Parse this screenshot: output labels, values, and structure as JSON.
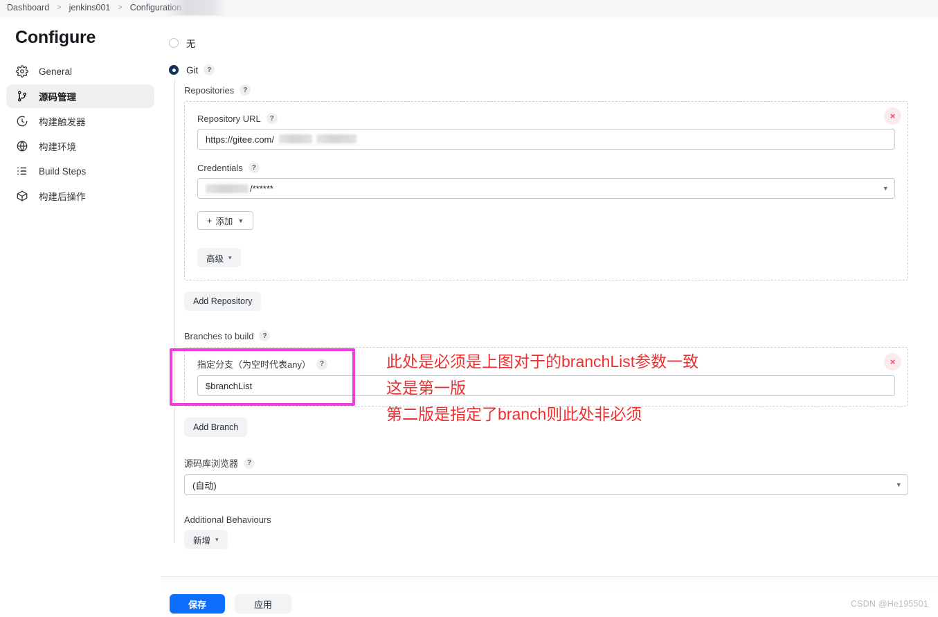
{
  "breadcrumb": {
    "items": [
      "Dashboard",
      "jenkins001",
      "Configuration"
    ],
    "separator": ">"
  },
  "sidebar": {
    "title": "Configure",
    "items": [
      {
        "label": "General",
        "icon": "gear-icon",
        "active": false
      },
      {
        "label": "源码管理",
        "icon": "git-branch-icon",
        "active": true
      },
      {
        "label": "构建触发器",
        "icon": "clock-icon",
        "active": false
      },
      {
        "label": "构建环境",
        "icon": "globe-icon",
        "active": false
      },
      {
        "label": "Build Steps",
        "icon": "list-icon",
        "active": false
      },
      {
        "label": "构建后操作",
        "icon": "package-icon",
        "active": false
      }
    ]
  },
  "scm": {
    "options": [
      {
        "label": "无",
        "selected": false
      },
      {
        "label": "Git",
        "selected": true,
        "help": "?"
      }
    ],
    "repositories_label": "Repositories",
    "help_glyph": "?",
    "repository": {
      "url_label": "Repository URL",
      "url_value": "https://gitee.com/",
      "url_redacted": true,
      "credentials_label": "Credentials",
      "credentials_value": "/******",
      "credentials_redacted": true,
      "add_credentials_label": "添加",
      "add_credentials_plus": "+",
      "advanced_label": "高级",
      "delete_glyph": "×"
    },
    "add_repository_label": "Add Repository",
    "branches_label": "Branches to build",
    "branch": {
      "name_label": "指定分支（为空时代表any）",
      "name_value": "$branchList",
      "delete_glyph": "×"
    },
    "add_branch_label": "Add Branch",
    "browser_label": "源码库浏览器",
    "browser_value": "(自动)",
    "additional_behaviours_label": "Additional Behaviours",
    "add_behaviour_label": "新增"
  },
  "annotations": {
    "color": "#ef2f2f",
    "highlight_color": "#ef3de0",
    "lines": [
      "此处是必须是上图对于的branchList参数一致",
      "这是第一版",
      "第二版是指定了branch则此处非必须"
    ]
  },
  "footer": {
    "save_label": "保存",
    "apply_label": "应用",
    "watermark": "CSDN @He195501"
  }
}
